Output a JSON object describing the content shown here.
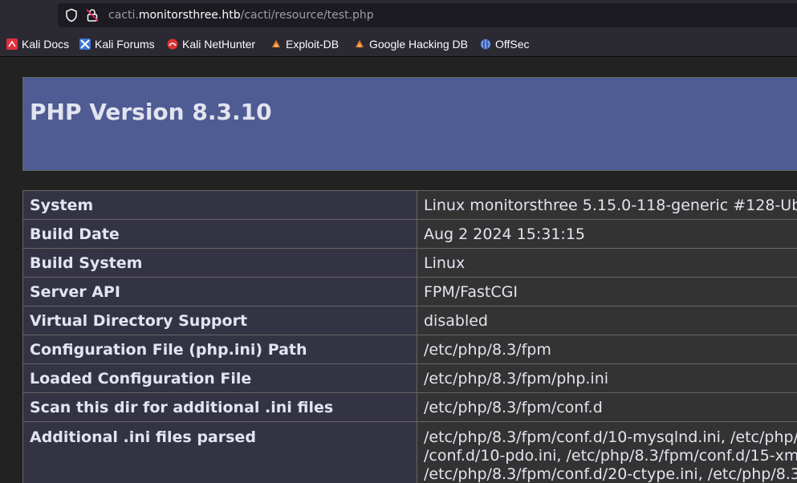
{
  "browser": {
    "url_prefix": "cacti.",
    "url_host": "monitorsthree.htb",
    "url_path": "/cacti/resource/test.php"
  },
  "bookmarks": [
    {
      "label": "Kali Docs",
      "icon": "kali-docs-icon"
    },
    {
      "label": "Kali Forums",
      "icon": "kali-forums-icon"
    },
    {
      "label": "Kali NetHunter",
      "icon": "kali-nethunter-icon"
    },
    {
      "label": "Exploit-DB",
      "icon": "exploit-db-icon"
    },
    {
      "label": "Google Hacking DB",
      "icon": "ghdb-icon"
    },
    {
      "label": "OffSec",
      "icon": "offsec-icon"
    }
  ],
  "page": {
    "title": "PHP Version 8.3.10",
    "rows": [
      {
        "key": "System",
        "value": "Linux monitorsthree 5.15.0-118-generic #128-Ub"
      },
      {
        "key": "Build Date",
        "value": "Aug 2 2024 15:31:15"
      },
      {
        "key": "Build System",
        "value": "Linux"
      },
      {
        "key": "Server API",
        "value": "FPM/FastCGI"
      },
      {
        "key": "Virtual Directory Support",
        "value": "disabled"
      },
      {
        "key": "Configuration File (php.ini) Path",
        "value": "/etc/php/8.3/fpm"
      },
      {
        "key": "Loaded Configuration File",
        "value": "/etc/php/8.3/fpm/php.ini"
      },
      {
        "key": "Scan this dir for additional .ini files",
        "value": "/etc/php/8.3/fpm/conf.d"
      }
    ],
    "last_row": {
      "key": "Additional .ini files parsed",
      "lines": [
        "/etc/php/8.3/fpm/conf.d/10-mysqlnd.ini, /etc/php/",
        "/conf.d/10-pdo.ini, /etc/php/8.3/fpm/conf.d/15-xm",
        "/etc/php/8.3/fpm/conf.d/20-ctype.ini, /etc/php/8.3"
      ]
    }
  },
  "colors": {
    "header_bg": "#4f5b93",
    "key_bg": "#333344",
    "value_bg": "#333333",
    "page_bg": "#222222"
  }
}
